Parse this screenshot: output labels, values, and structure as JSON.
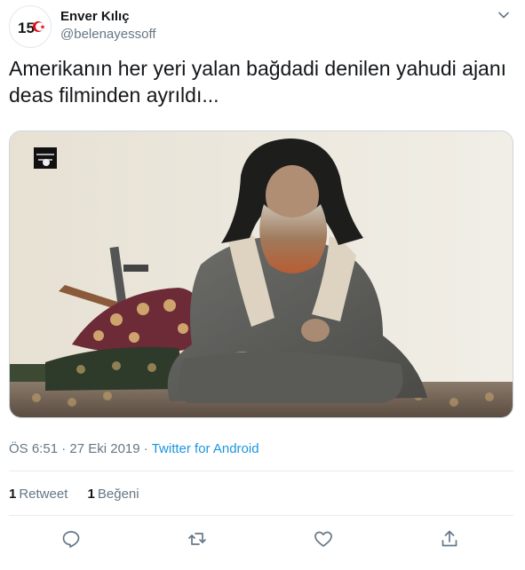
{
  "author": {
    "display_name": "Enver Kılıç",
    "handle": "@belenayessoff",
    "avatar_text": "15"
  },
  "tweet": {
    "text": "Amerikanın her yeri yalan bağdadi denilen yahudi ajanı deas filminden ayrıldı..."
  },
  "meta": {
    "time": "ÖS 6:51",
    "separator1": " · ",
    "date": "27 Eki 2019",
    "separator2": " · ",
    "source": "Twitter for Android"
  },
  "stats": {
    "retweets_count": "1",
    "retweets_label": "Retweet",
    "likes_count": "1",
    "likes_label": "Beğeni"
  },
  "icons": {
    "caret": "chevron-down-icon",
    "reply": "reply-icon",
    "retweet": "retweet-icon",
    "like": "heart-icon",
    "share": "share-icon"
  },
  "colors": {
    "text": "#14171a",
    "secondary": "#657786",
    "link": "#1b95e0",
    "divider": "#e6ecf0",
    "avatar_red": "#e30a17"
  }
}
